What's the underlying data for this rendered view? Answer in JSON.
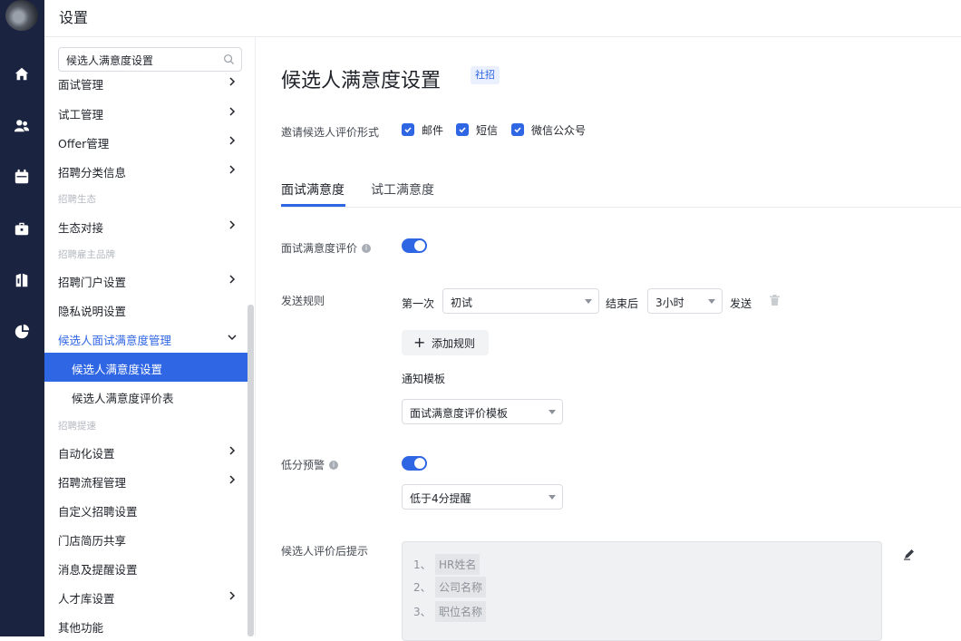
{
  "topbar": {
    "title": "设置"
  },
  "rail": {
    "icons": [
      "home-icon",
      "users-icon",
      "calendar-icon",
      "briefcase-icon",
      "book-icon",
      "pie-chart-icon"
    ]
  },
  "sidebar": {
    "search_value": "候选人满意度设置",
    "items": [
      {
        "label": "面试管理",
        "chevron": true
      },
      {
        "label": "试工管理",
        "chevron": true
      },
      {
        "label": "Offer管理",
        "chevron": true
      },
      {
        "label": "招聘分类信息",
        "chevron": true
      }
    ],
    "group_ecology": "招聘生态",
    "ecology_item": "生态对接",
    "group_brand": "招聘雇主品牌",
    "brand_items": [
      "招聘门户设置",
      "隐私说明设置",
      "候选人面试满意度管理"
    ],
    "sub_items": [
      "候选人满意度设置",
      "候选人满意度评价表"
    ],
    "group_speed": "招聘提速",
    "speed_items": [
      "自动化设置",
      "招聘流程管理",
      "自定义招聘设置",
      "门店简历共享",
      "消息及提醒设置",
      "人才库设置",
      "其他功能"
    ]
  },
  "main": {
    "title": "候选人满意度设置",
    "badge": "社招",
    "invite_label": "邀请候选人评价形式",
    "channels": [
      "邮件",
      "短信",
      "微信公众号"
    ],
    "tabs": [
      "面试满意度",
      "试工满意度"
    ],
    "eval_label": "面试满意度评价",
    "send_rule_label": "发送规则",
    "first_label": "第一次",
    "first_select": "初试",
    "after_label": "结束后",
    "time_select": "3小时",
    "send_label": "发送",
    "add_rule": "添加规则",
    "template_label": "通知模板",
    "template_select": "面试满意度评价模板",
    "low_score_label": "低分预警",
    "low_score_select": "低于4分提醒",
    "tip_label": "候选人评价后提示",
    "tip_nums": [
      "1、",
      "2、",
      "3、"
    ],
    "tip_items": [
      "HR姓名",
      "公司名称",
      "职位名称"
    ]
  },
  "colors": {
    "accent": "#2f66e4",
    "rail_bg": "#1a2340"
  }
}
